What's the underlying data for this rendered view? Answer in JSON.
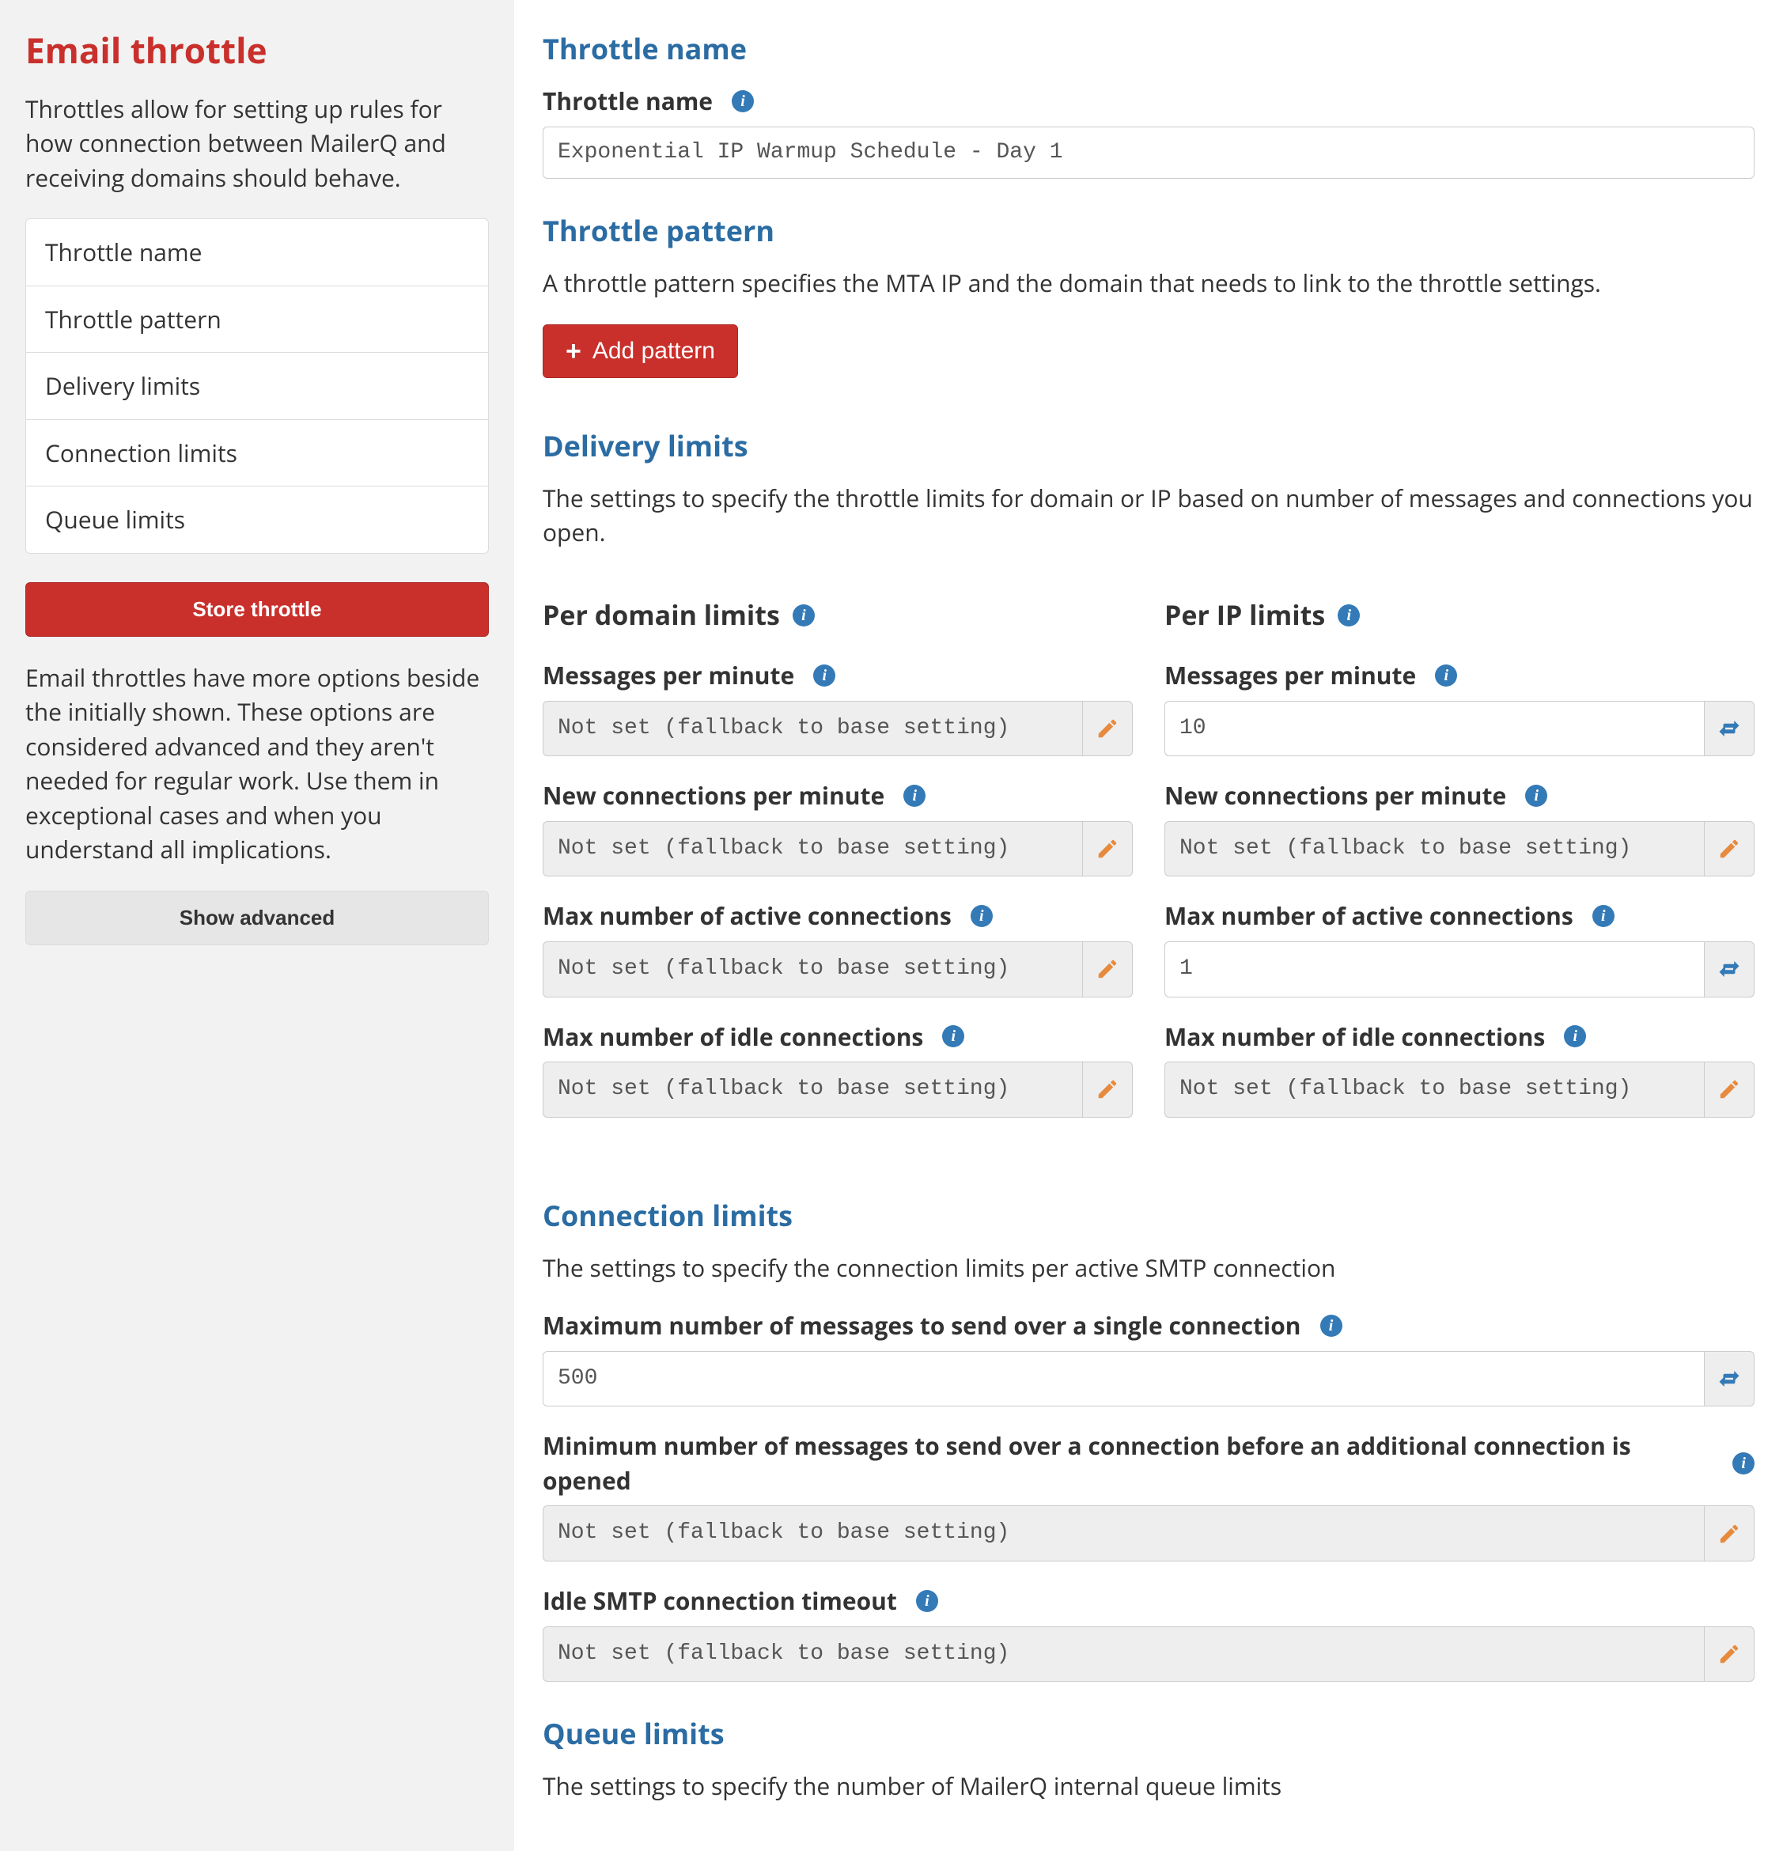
{
  "sidebar": {
    "title": "Email throttle",
    "intro": "Throttles allow for setting up rules for how connection between MailerQ and receiving domains should behave.",
    "nav": [
      "Throttle name",
      "Throttle pattern",
      "Delivery limits",
      "Connection limits",
      "Queue limits"
    ],
    "store_button": "Store throttle",
    "advanced_text": "Email throttles have more options beside the initially shown. These options are considered advanced and they aren't needed for regular work. Use them in exceptional cases and when you understand all implications.",
    "show_advanced": "Show advanced"
  },
  "throttle_name": {
    "heading": "Throttle name",
    "label": "Throttle name",
    "value": "Exponential IP Warmup Schedule - Day 1"
  },
  "throttle_pattern": {
    "heading": "Throttle pattern",
    "desc": "A throttle pattern specifies the MTA IP and the domain that needs to link to the throttle settings.",
    "add_button": "Add pattern"
  },
  "delivery_limits": {
    "heading": "Delivery limits",
    "desc": "The settings to specify the throttle limits for domain or IP based on number of messages and connections you open.",
    "domain_heading": "Per domain limits",
    "ip_heading": "Per IP limits",
    "fallback": "Not set (fallback to base setting)",
    "domain": {
      "msgs_per_min_label": "Messages per minute",
      "msgs_per_min_value": "",
      "new_conn_label": "New connections per minute",
      "new_conn_value": "",
      "max_active_label": "Max number of active connections",
      "max_active_value": "",
      "max_idle_label": "Max number of idle connections",
      "max_idle_value": ""
    },
    "ip": {
      "msgs_per_min_label": "Messages per minute",
      "msgs_per_min_value": "10",
      "new_conn_label": "New connections per minute",
      "new_conn_value": "",
      "max_active_label": "Max number of active connections",
      "max_active_value": "1",
      "max_idle_label": "Max number of idle connections",
      "max_idle_value": ""
    }
  },
  "connection_limits": {
    "heading": "Connection limits",
    "desc": "The settings to specify the connection limits per active SMTP connection",
    "max_msgs_label": "Maximum number of messages to send over a single connection",
    "max_msgs_value": "500",
    "min_msgs_label": "Minimum number of messages to send over a connection before an additional connection is opened",
    "min_msgs_value": "",
    "idle_timeout_label": "Idle SMTP connection timeout",
    "idle_timeout_value": "",
    "fallback": "Not set (fallback to base setting)"
  },
  "queue_limits": {
    "heading": "Queue limits",
    "desc": "The settings to specify the number of MailerQ internal queue limits"
  }
}
